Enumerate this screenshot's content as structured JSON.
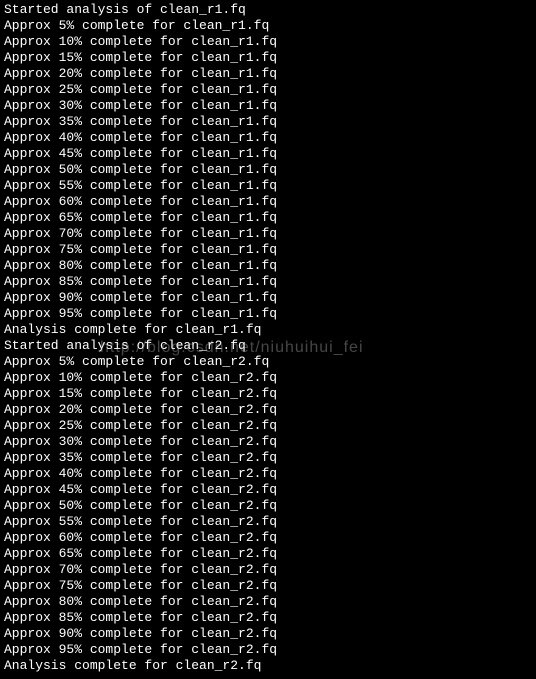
{
  "terminal": {
    "lines": [
      "Started analysis of clean_r1.fq",
      "Approx 5% complete for clean_r1.fq",
      "Approx 10% complete for clean_r1.fq",
      "Approx 15% complete for clean_r1.fq",
      "Approx 20% complete for clean_r1.fq",
      "Approx 25% complete for clean_r1.fq",
      "Approx 30% complete for clean_r1.fq",
      "Approx 35% complete for clean_r1.fq",
      "Approx 40% complete for clean_r1.fq",
      "Approx 45% complete for clean_r1.fq",
      "Approx 50% complete for clean_r1.fq",
      "Approx 55% complete for clean_r1.fq",
      "Approx 60% complete for clean_r1.fq",
      "Approx 65% complete for clean_r1.fq",
      "Approx 70% complete for clean_r1.fq",
      "Approx 75% complete for clean_r1.fq",
      "Approx 80% complete for clean_r1.fq",
      "Approx 85% complete for clean_r1.fq",
      "Approx 90% complete for clean_r1.fq",
      "Approx 95% complete for clean_r1.fq",
      "Analysis complete for clean_r1.fq",
      "Started analysis of clean_r2.fq",
      "Approx 5% complete for clean_r2.fq",
      "Approx 10% complete for clean_r2.fq",
      "Approx 15% complete for clean_r2.fq",
      "Approx 20% complete for clean_r2.fq",
      "Approx 25% complete for clean_r2.fq",
      "Approx 30% complete for clean_r2.fq",
      "Approx 35% complete for clean_r2.fq",
      "Approx 40% complete for clean_r2.fq",
      "Approx 45% complete for clean_r2.fq",
      "Approx 50% complete for clean_r2.fq",
      "Approx 55% complete for clean_r2.fq",
      "Approx 60% complete for clean_r2.fq",
      "Approx 65% complete for clean_r2.fq",
      "Approx 70% complete for clean_r2.fq",
      "Approx 75% complete for clean_r2.fq",
      "Approx 80% complete for clean_r2.fq",
      "Approx 85% complete for clean_r2.fq",
      "Approx 90% complete for clean_r2.fq",
      "Approx 95% complete for clean_r2.fq",
      "Analysis complete for clean_r2.fq"
    ]
  },
  "watermark": {
    "text": "http://blog.csdn.net/niuhuihui_fei"
  }
}
